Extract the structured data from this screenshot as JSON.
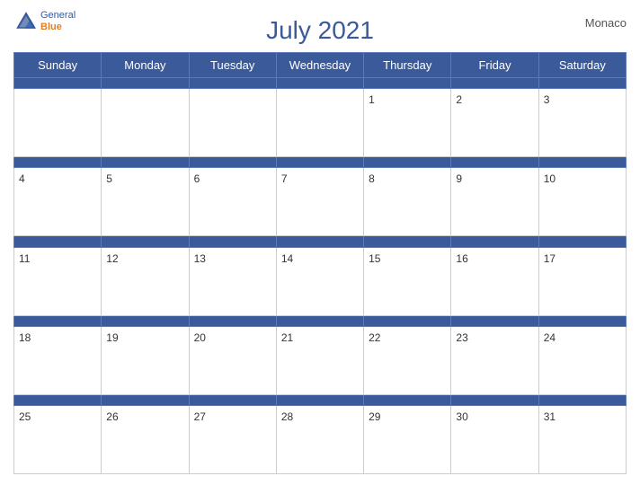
{
  "calendar": {
    "title": "July 2021",
    "location": "Monaco",
    "days_of_week": [
      "Sunday",
      "Monday",
      "Tuesday",
      "Wednesday",
      "Thursday",
      "Friday",
      "Saturday"
    ],
    "weeks": [
      [
        null,
        null,
        null,
        null,
        1,
        2,
        3
      ],
      [
        4,
        5,
        6,
        7,
        8,
        9,
        10
      ],
      [
        11,
        12,
        13,
        14,
        15,
        16,
        17
      ],
      [
        18,
        19,
        20,
        21,
        22,
        23,
        24
      ],
      [
        25,
        26,
        27,
        28,
        29,
        30,
        31
      ]
    ]
  },
  "logo": {
    "line1": "General",
    "line2": "Blue"
  },
  "colors": {
    "header_bg": "#3a5a99",
    "header_text": "#ffffff",
    "title_color": "#3a5a99",
    "border": "#cccccc"
  }
}
